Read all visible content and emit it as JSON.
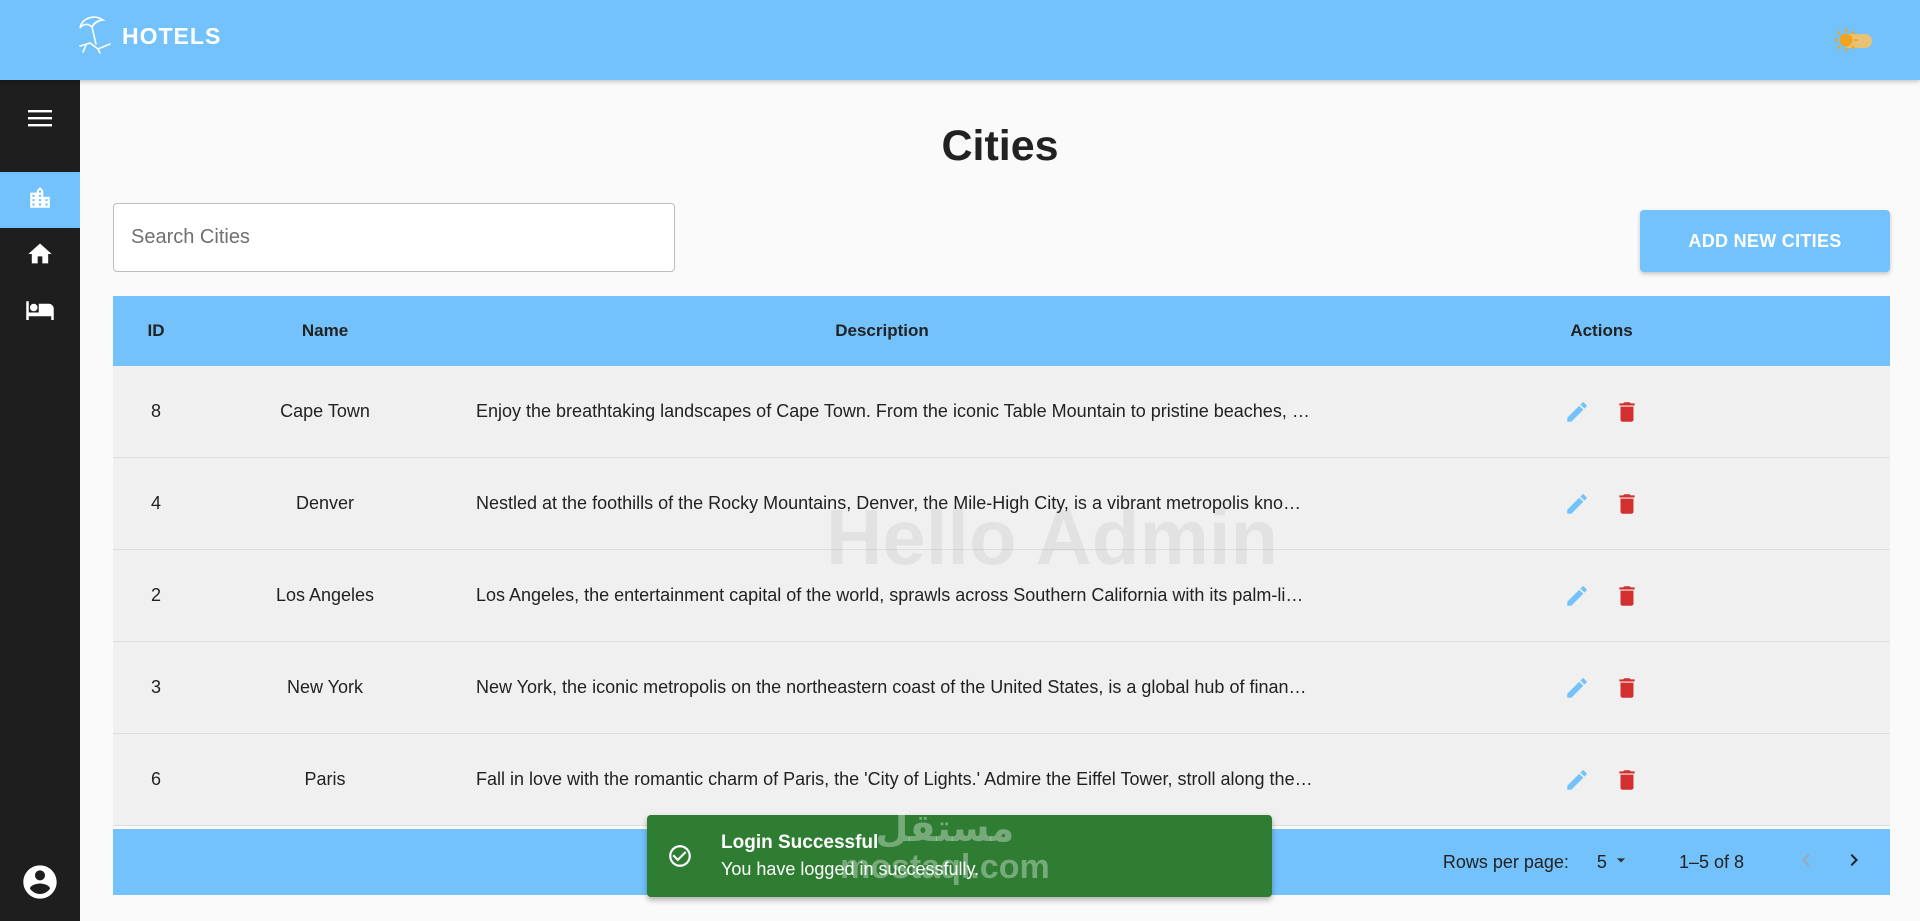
{
  "header": {
    "brand_name": "HOTELS",
    "brand_icon": "beach-umbrella-chair-icon",
    "theme_toggle_icon": "sun-toggle-icon",
    "bg_color": "#73c2fb"
  },
  "sidebar": {
    "items": [
      {
        "icon": "menu-icon",
        "active": false
      },
      {
        "icon": "city-buildings-icon",
        "active": true
      },
      {
        "icon": "home-icon",
        "active": false
      },
      {
        "icon": "hotel-bed-icon",
        "active": false
      }
    ],
    "profile_icon": "account-circle-icon",
    "bg_color": "#1e1e1e"
  },
  "page": {
    "title": "Cities",
    "search_placeholder": "Search Cities",
    "add_button_label": "ADD NEW CITIES",
    "watermark": "Hello Admin"
  },
  "table": {
    "headers": {
      "id": "ID",
      "name": "Name",
      "description": "Description",
      "actions": "Actions"
    },
    "rows": [
      {
        "id": "8",
        "name": "Cape Town",
        "description": "Enjoy the breathtaking landscapes of Cape Town. From the iconic Table Mountain to pristine beaches, e…"
      },
      {
        "id": "4",
        "name": "Denver",
        "description": "Nestled at the foothills of the Rocky Mountains, Denver, the Mile-High City, is a vibrant metropolis know…"
      },
      {
        "id": "2",
        "name": "Los Angeles",
        "description": "Los Angeles, the entertainment capital of the world, sprawls across Southern California with its palm-lin…"
      },
      {
        "id": "3",
        "name": "New York",
        "description": "New York, the iconic metropolis on the northeastern coast of the United States, is a global hub of financ…"
      },
      {
        "id": "6",
        "name": "Paris",
        "description": "Fall in love with the romantic charm of Paris, the 'City of Lights.' Admire the Eiffel Tower, stroll along the …"
      }
    ],
    "edit_icon": "pencil-edit-icon",
    "delete_icon": "trash-delete-icon",
    "edit_color": "#73c2fb",
    "delete_color": "#d32f2f"
  },
  "pagination": {
    "rows_per_page_label": "Rows per page:",
    "rows_per_page_value": "5",
    "range": "1–5 of 8",
    "prev_icon": "chevron-left-icon",
    "next_icon": "chevron-right-icon"
  },
  "toast": {
    "title": "Login Successful",
    "message": "You have logged in successfully.",
    "icon": "check-circle-icon",
    "bg_color": "#2e7d32"
  },
  "site_watermark": {
    "arabic": "مستقل",
    "latin": "mostaql.com"
  }
}
